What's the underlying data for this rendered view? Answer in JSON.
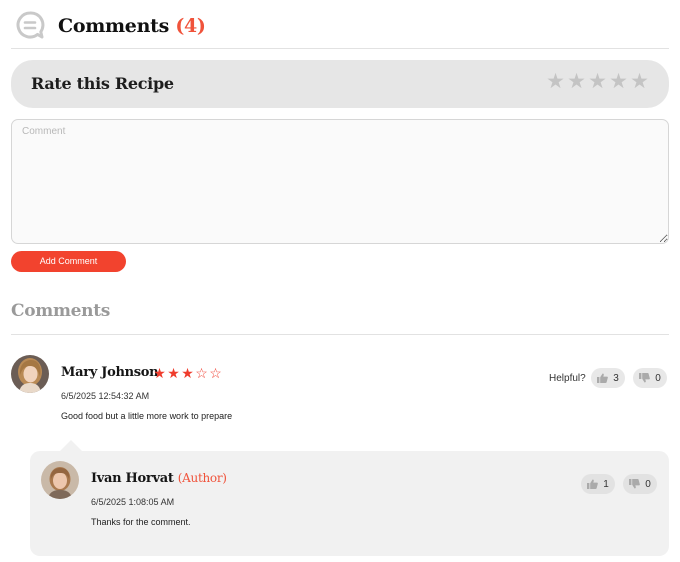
{
  "header": {
    "title": "Comments",
    "count": "(4)",
    "icon": "comment-bubble-icon"
  },
  "rating": {
    "label": "Rate this Recipe",
    "stars": [
      "★",
      "★",
      "★",
      "★",
      "★"
    ],
    "star_color": "#c4c4c4"
  },
  "form": {
    "placeholder": "Comment",
    "submit_label": "Add Comment"
  },
  "comments_section": {
    "title": "Comments"
  },
  "comments": [
    {
      "name": "Mary Johnson",
      "rating": 3,
      "rating_max": 5,
      "date": "6/5/2025 12:54:32 AM",
      "text": "Good food but a little more work to prepare",
      "helpful_label": "Helpful?",
      "likes": "3",
      "dislikes": "0",
      "reply": {
        "name": "Ivan Horvat",
        "tag": "(Author)",
        "date": "6/5/2025 1:08:05 AM",
        "text": "Thanks for the comment.",
        "likes": "1",
        "dislikes": "0"
      }
    }
  ],
  "colors": {
    "accent": "#f0533b",
    "button": "#f2432e",
    "rate_bar": "#e6e6e6",
    "reply_bg": "#f1f1f1"
  }
}
